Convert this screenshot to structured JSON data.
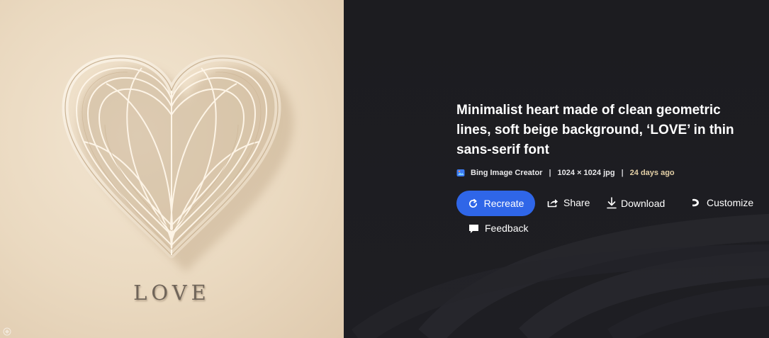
{
  "image": {
    "love_text": "LOVE"
  },
  "details": {
    "title": "Minimalist heart made of clean geometric lines, soft beige background, ‘LOVE’ in thin sans-serif font",
    "creator": "Bing Image Creator",
    "separator": "|",
    "dimensions": "1024 × 1024 jpg",
    "age": "24 days ago",
    "creator_icon": "bing-image-creator-icon"
  },
  "actions": {
    "recreate": "Recreate",
    "share": "Share",
    "download": "Download",
    "customize": "Customize",
    "feedback": "Feedback"
  },
  "colors": {
    "accent": "#2f66e8",
    "panel_background": "#1c1c20",
    "image_background": "#ead9c0",
    "age_text": "#e3cfa6"
  }
}
